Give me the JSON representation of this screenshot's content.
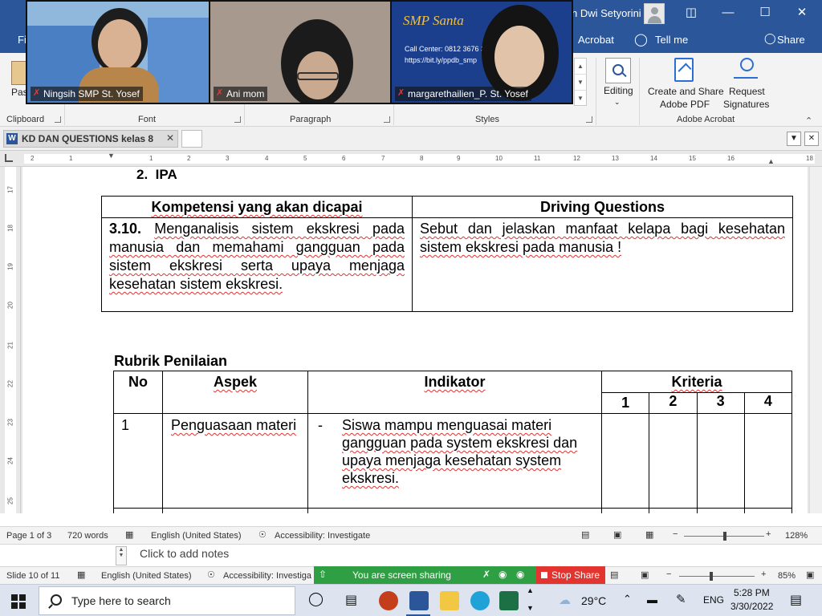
{
  "word": {
    "user_name": "h Dwi Setyorini",
    "tabs": [
      "Fi",
      "Acrobat",
      "Tell me",
      "Share"
    ],
    "ribbon": {
      "paste_label": "Pas",
      "groups": [
        "Clipboard",
        "Font",
        "Paragraph",
        "Styles",
        "Adobe Acrobat"
      ],
      "editing_label": "Editing",
      "create_share_label_1": "Create and Share",
      "create_share_label_2": "Adobe PDF",
      "request_label_1": "Request",
      "request_label_2": "Signatures"
    },
    "doc_tab_title": "KD DAN QUESTIONS kelas 8",
    "ruler_ticks": [
      "2",
      "1",
      "1",
      "2",
      "3",
      "4",
      "5",
      "6",
      "7",
      "8",
      "9",
      "10",
      "11",
      "12",
      "13",
      "14",
      "15",
      "16",
      "18"
    ],
    "vruler_ticks": [
      "17",
      "18",
      "19",
      "20",
      "21",
      "22",
      "23",
      "24",
      "25"
    ],
    "status": {
      "page": "Page 1 of 3",
      "words": "720 words",
      "language": "English (United States)",
      "accessibility": "Accessibility: Investigate",
      "zoom": "128%"
    }
  },
  "document": {
    "heading_number": "2.",
    "heading_text": "IPA",
    "kd_table": {
      "headers": [
        "Kompetensi yang akan dicapai",
        "Driving Questions"
      ],
      "kd_number": "3.10.",
      "kd_text": "Menganalisis sistem ekskresi pada manusia dan memahami gangguan pada sistem ekskresi serta upaya menjaga kesehatan sistem ekskresi.",
      "question": "Sebut dan jelaskan manfaat kelapa bagi kesehatan sistem ekskresi pada manusia !"
    },
    "rubrik_title": "Rubrik Penilaian",
    "rubrik_table": {
      "headers": {
        "no": "No",
        "aspek": "Aspek",
        "indikator": "Indikator",
        "kriteria": "Kriteria"
      },
      "scores": [
        "1",
        "2",
        "3",
        "4"
      ],
      "rows": [
        {
          "no": "1",
          "aspek": "Penguasaan materi",
          "dash": "-",
          "indikator": "Siswa mampu menguasai materi gangguan pada system ekskresi dan upaya menjaga kesehatan system ekskresi."
        }
      ]
    }
  },
  "zoom_participants": [
    {
      "name": "Ningsih SMP St. Yosef"
    },
    {
      "name": "Ani mom"
    },
    {
      "name": "margarethailien_P. St. Yosef"
    }
  ],
  "zoom_banner": {
    "title": "SMP Santa",
    "contact": "Call Center: 0812 3676 35",
    "link": "https://bit.ly/ppdb_smp"
  },
  "powerpoint": {
    "notes_placeholder": "Click to add notes",
    "slide_info": "Slide 10 of 11",
    "language": "English (United States)",
    "accessibility": "Accessibility: Investiga",
    "zoom": "85%"
  },
  "screen_share": {
    "status_text": "You are screen sharing",
    "stop_label": "Stop Share"
  },
  "taskbar": {
    "search_placeholder": "Type here to search",
    "temperature": "29°C",
    "language": "ENG",
    "time": "5:28 PM",
    "date": "3/30/2022"
  },
  "colors": {
    "word_blue": "#2b579a",
    "share_green": "#2ea043",
    "stop_red": "#e3342f"
  }
}
